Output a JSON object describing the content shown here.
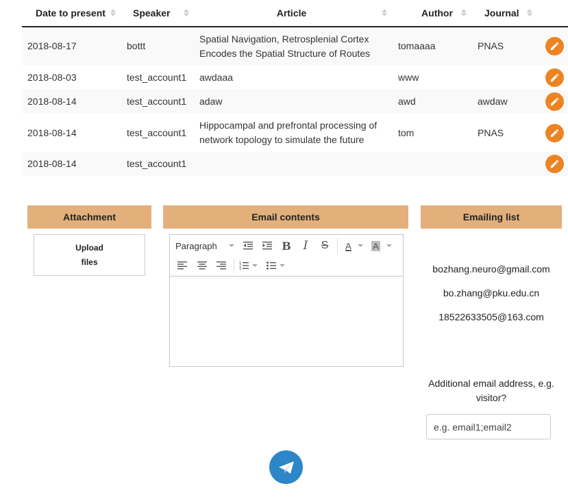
{
  "table": {
    "columns": [
      "Date to present",
      "Speaker",
      "Article",
      "Author",
      "Journal"
    ],
    "rows": [
      {
        "date": "2018-08-17",
        "speaker": "bottt",
        "article": "Spatial Navigation, Retrosplenial Cortex Encodes the Spatial Structure of Routes",
        "author": "tomaaaa",
        "journal": "PNAS"
      },
      {
        "date": "2018-08-03",
        "speaker": "test_account1",
        "article": "awdaaa",
        "author": "www",
        "journal": ""
      },
      {
        "date": "2018-08-14",
        "speaker": "test_account1",
        "article": "adaw",
        "author": "awd",
        "journal": "awdaw"
      },
      {
        "date": "2018-08-14",
        "speaker": "test_account1",
        "article": "Hippocampal and prefrontal processing of network topology to simulate the future",
        "author": "tom",
        "journal": "PNAS"
      },
      {
        "date": "2018-08-14",
        "speaker": "test_account1",
        "article": "",
        "author": "",
        "journal": ""
      }
    ],
    "edit_icon": "pencil-icon",
    "edit_color": "#ec8424"
  },
  "attachment": {
    "title": "Attachment",
    "upload_line1": "Upload",
    "upload_line2": "files"
  },
  "email": {
    "title": "Email contents",
    "format_select": "Paragraph",
    "bold": "B",
    "italic": "I",
    "strike": "S",
    "forecolor": "A",
    "backcolor": "A"
  },
  "emailing_list": {
    "title": "Emailing list",
    "addresses": [
      "bozhang.neuro@gmail.com",
      "bo.zhang@pku.edu.cn",
      "18522633505@163.com"
    ],
    "additional_label": "Additional email address, e.g. visitor?",
    "additional_placeholder": "e.g. email1;email2"
  },
  "send": {
    "icon": "paper-plane-icon",
    "color": "#2d86c7"
  },
  "colors": {
    "panel_header": "#e3b07c",
    "row_stripe": "#f9f9f9"
  }
}
